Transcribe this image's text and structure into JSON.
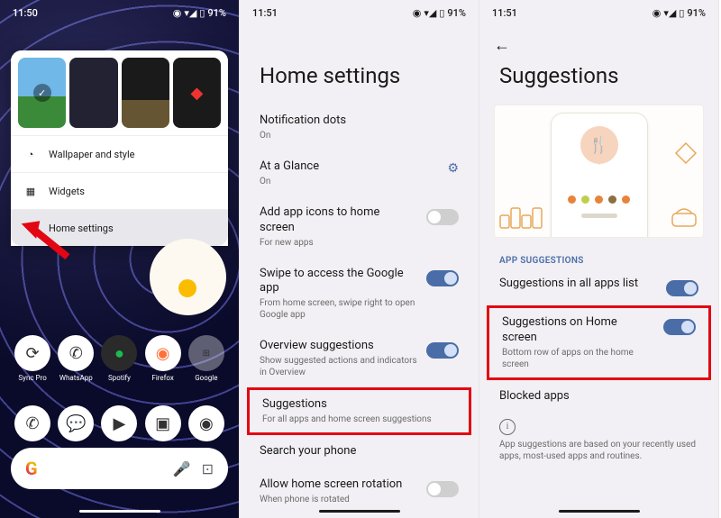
{
  "status": {
    "time1": "11:50",
    "time2": "11:51",
    "time3": "11:51",
    "battery": "91%"
  },
  "screen1": {
    "menu": {
      "wallpaper": "Wallpaper and style",
      "widgets": "Widgets",
      "home_settings": "Home settings"
    },
    "apps": [
      "Sync Pro",
      "WhatsApp",
      "Spotify",
      "Firefox",
      "Google"
    ],
    "search_letter": "G"
  },
  "screen2": {
    "title": "Home settings",
    "items": {
      "notif": {
        "title": "Notification dots",
        "sub": "On"
      },
      "glance": {
        "title": "At a Glance",
        "sub": "On"
      },
      "add_icons": {
        "title": "Add app icons to home screen",
        "sub": "For new apps"
      },
      "swipe": {
        "title": "Swipe to access the Google app",
        "sub": "From home screen, swipe right to open Google app"
      },
      "overview": {
        "title": "Overview suggestions",
        "sub": "Show suggested actions and indicators in Overview"
      },
      "suggestions": {
        "title": "Suggestions",
        "sub": "For all apps and home screen suggestions"
      },
      "search": {
        "title": "Search your phone"
      },
      "rotation": {
        "title": "Allow home screen rotation",
        "sub": "When phone is rotated"
      }
    }
  },
  "screen3": {
    "title": "Suggestions",
    "section": "APP SUGGESTIONS",
    "items": {
      "all_apps": {
        "title": "Suggestions in all apps list"
      },
      "home": {
        "title": "Suggestions on Home screen",
        "sub": "Bottom row of apps on the home screen"
      },
      "blocked": {
        "title": "Blocked apps"
      }
    },
    "info": "App suggestions are based on your recently used apps, most-used apps and routines."
  }
}
